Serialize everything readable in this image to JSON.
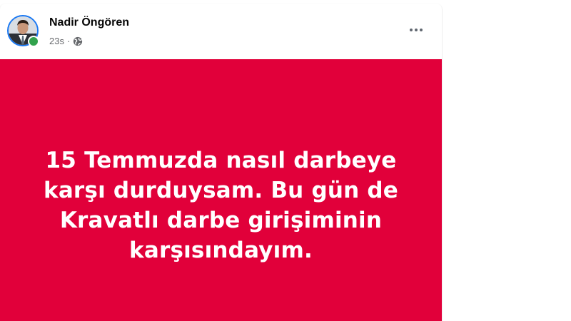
{
  "post": {
    "author_name": "Nadir Öngören",
    "timestamp": "23s",
    "separator": "·",
    "privacy_icon": "globe-icon",
    "more_icon": "more-horizontal-icon",
    "avatar_icon": "avatar",
    "online_status": "online",
    "body_text": "15 Temmuzda nasıl darbeye karşı durduysam. Bu gün de Kravatlı darbe girişiminin karşısındayım.",
    "background_color": "#e1003a",
    "text_color": "#ffffff"
  },
  "colors": {
    "accent": "#1877f2",
    "online": "#31a24c",
    "meta_text": "#65676b",
    "name_text": "#050505"
  }
}
